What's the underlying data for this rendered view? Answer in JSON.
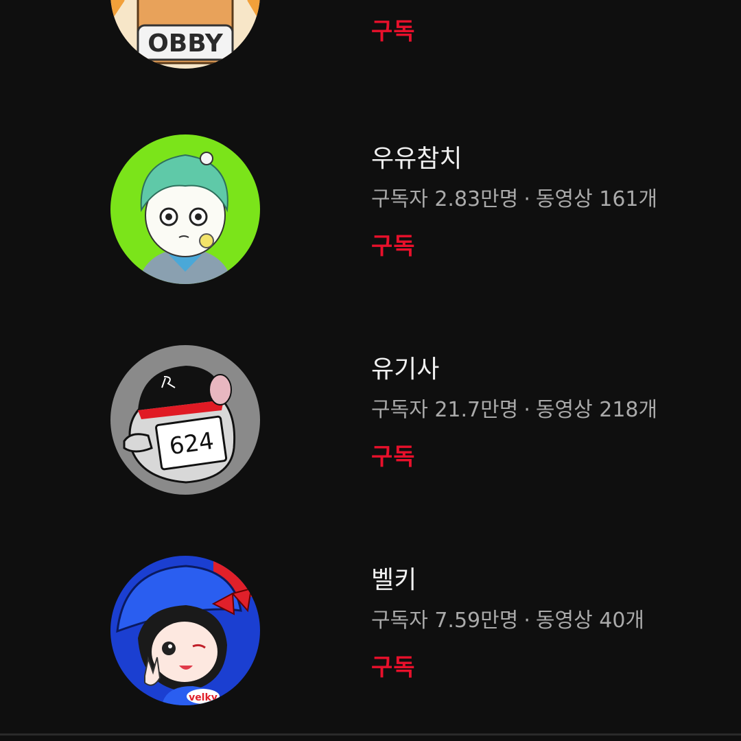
{
  "channels": [
    {
      "name": "",
      "subscribers": "",
      "videos": "",
      "subscribe_label": "구독",
      "avatar_text": "OBBY",
      "avatar_colors": {
        "bg": "#f4ad3a",
        "accent": "#e07a1d",
        "face": "#f7f2e4"
      }
    },
    {
      "name": "우유참치",
      "subscribers": "구독자 2.83만명",
      "videos": "동영상 161개",
      "subscribe_label": "구독",
      "avatar_colors": {
        "bg": "#7be41a",
        "hair": "#5fc9a8",
        "skin": "#fbfbf5"
      }
    },
    {
      "name": "유기사",
      "subscribers": "구독자 21.7만명",
      "videos": "동영상 218개",
      "subscribe_label": "구독",
      "avatar_text": "624",
      "avatar_colors": {
        "bg": "#8a8a8a",
        "cap": "#111111",
        "band": "#e01a24"
      }
    },
    {
      "name": "벨키",
      "subscribers": "구독자 7.59만명",
      "videos": "동영상 40개",
      "subscribe_label": "구독",
      "avatar_text": "velky",
      "avatar_colors": {
        "bg": "#1b3fd1",
        "hat": "#2a5ef0",
        "bow": "#e0202a"
      }
    }
  ],
  "separator": "·"
}
